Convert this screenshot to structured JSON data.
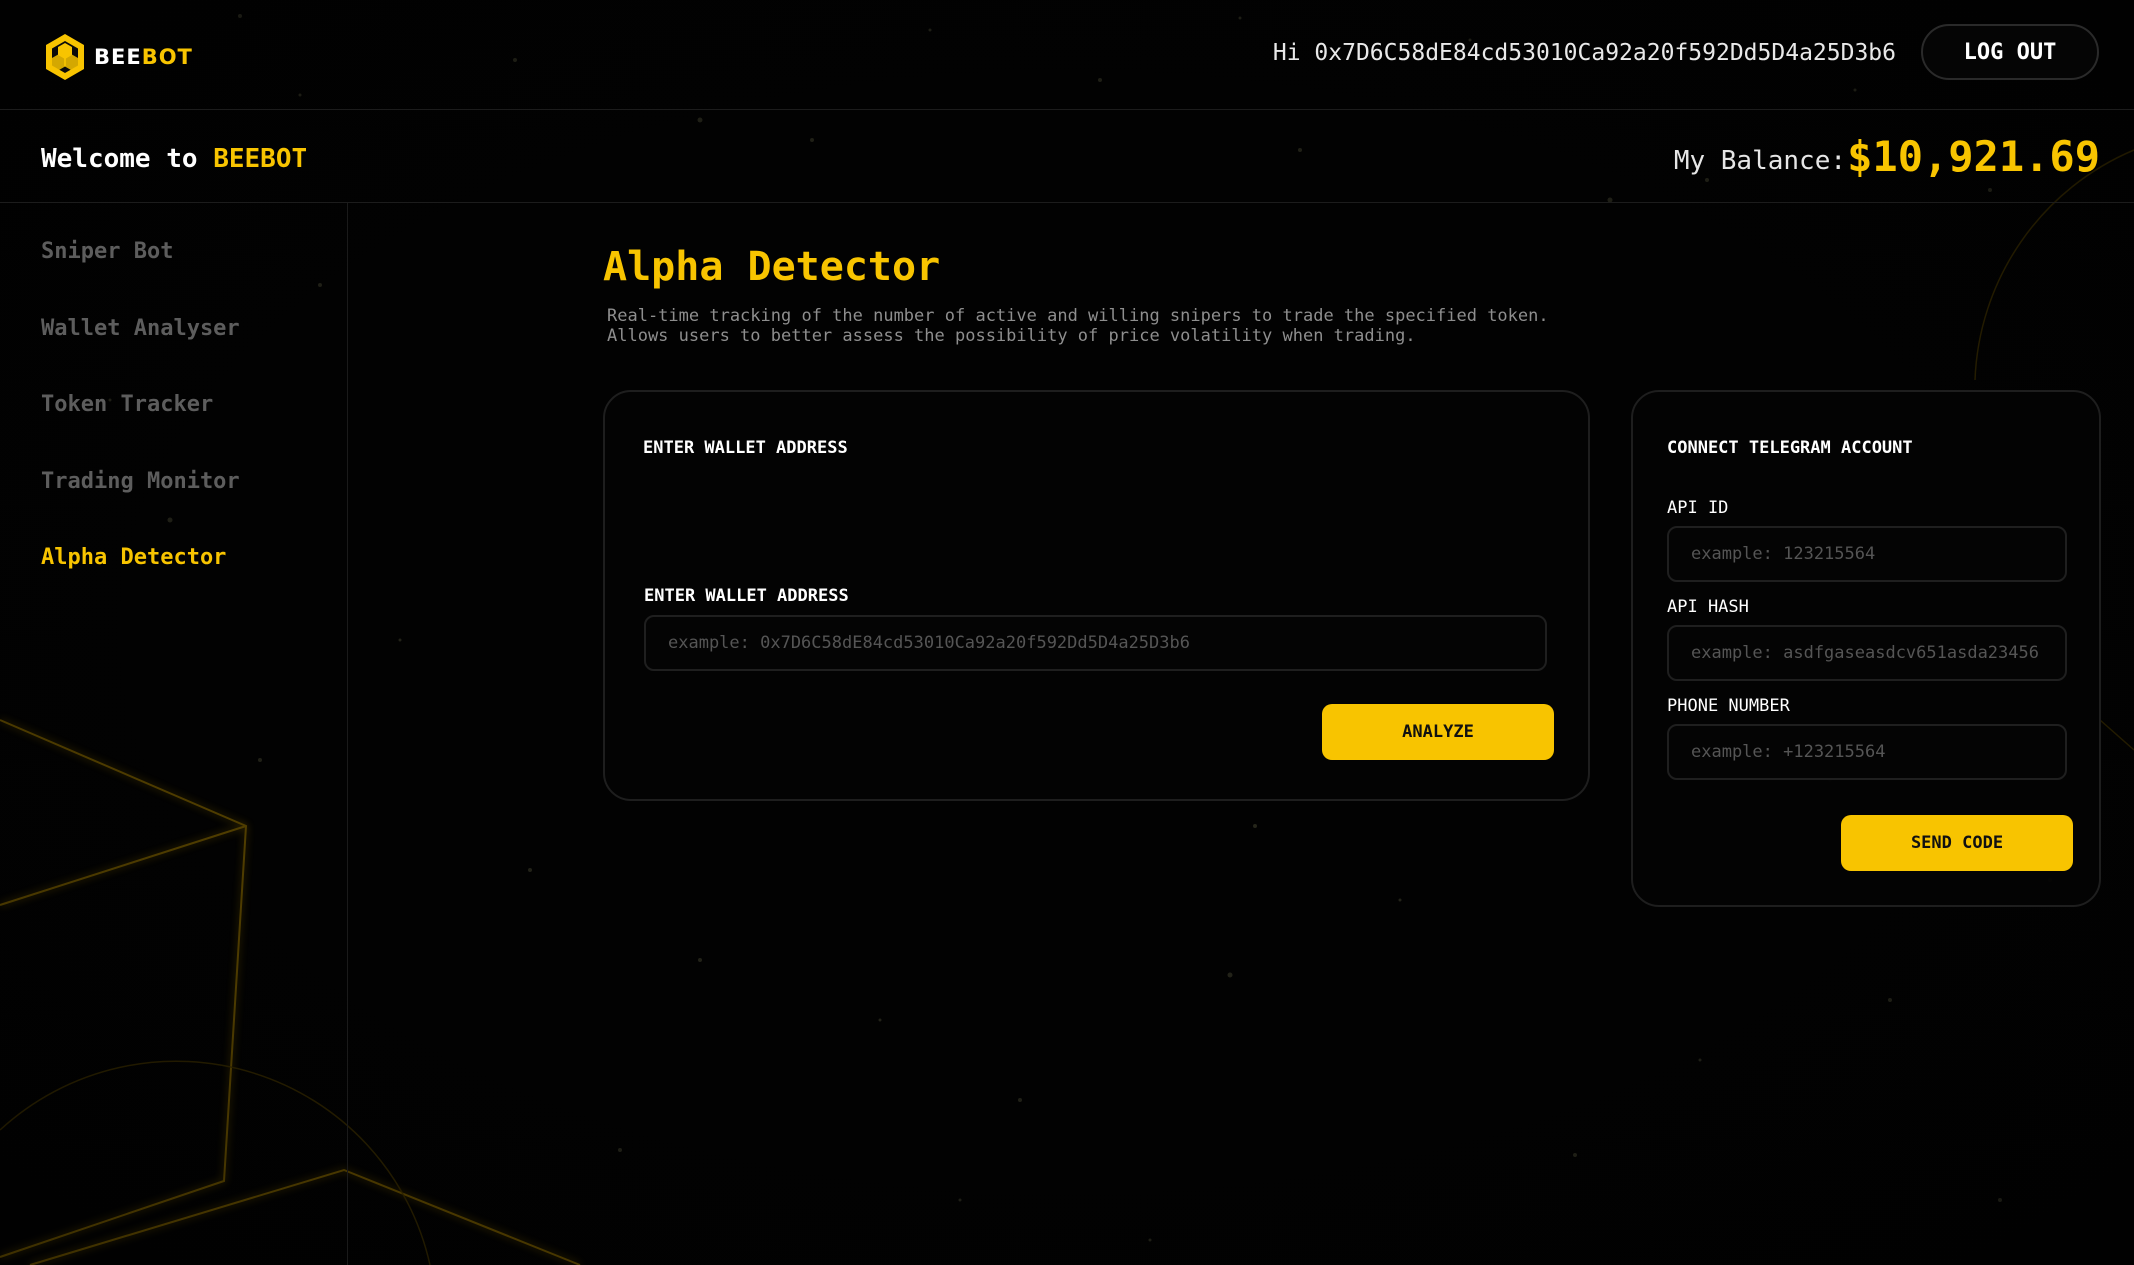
{
  "app": {
    "logo_bee": "BEE",
    "logo_bot": "BOT",
    "greeting": "Hi 0x7D6C58dE84cd53010Ca92a20f592Dd5D4a25D3b6",
    "logout_label": "LOG OUT"
  },
  "welcome": {
    "prefix": "Welcome to",
    "brand": "BEEBOT",
    "balance_label": "My Balance:",
    "balance_value": "$10,921.69"
  },
  "sidebar": {
    "items": [
      {
        "label": "Sniper Bot",
        "active": false
      },
      {
        "label": "Wallet Analyser",
        "active": false
      },
      {
        "label": "Token Tracker",
        "active": false
      },
      {
        "label": "Trading Monitor",
        "active": false
      },
      {
        "label": "Alpha Detector",
        "active": true
      }
    ]
  },
  "main": {
    "title": "Alpha Detector",
    "desc_line1": "Real-time tracking of the number of active and willing snipers to trade the specified token.",
    "desc_line2": "Allows users to better assess the possibility of price volatility when trading."
  },
  "wallet_card": {
    "heading": "ENTER WALLET ADDRESS",
    "field_label": "ENTER WALLET ADDRESS",
    "placeholder": "example: 0x7D6C58dE84cd53010Ca92a20f592Dd5D4a25D3b6",
    "value": "",
    "button_label": "ANALYZE"
  },
  "telegram_card": {
    "heading": "CONNECT TELEGRAM ACCOUNT",
    "api_id_label": "API ID",
    "api_id_placeholder": "example: 123215564",
    "api_hash_label": "API HASH",
    "api_hash_placeholder": "example: asdfgaseasdcv651asda23456",
    "phone_label": "PHONE NUMBER",
    "phone_placeholder": "example: +123215564",
    "button_label": "SEND CODE"
  },
  "colors": {
    "accent": "#f8c400",
    "background": "#020202",
    "muted_text": "#5d5d5d"
  }
}
